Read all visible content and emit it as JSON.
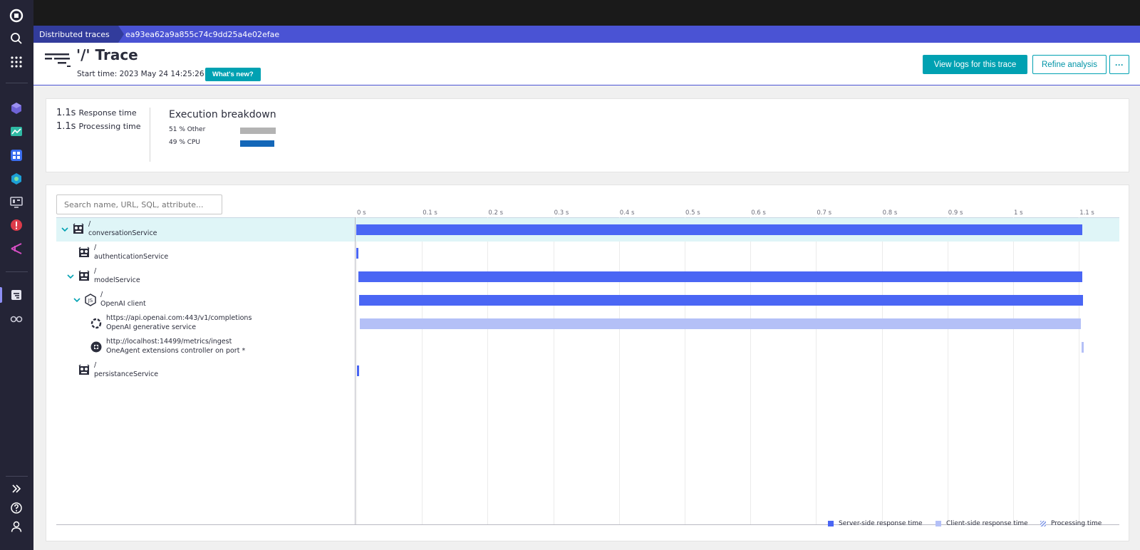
{
  "breadcrumb": {
    "first": "Distributed traces",
    "second": "ea93ea62a9a855c74c9dd25a4e02efae"
  },
  "header": {
    "title": "'/' Trace",
    "start_time": "Start time: 2023 May 24 14:25:26",
    "whats_new": "What's new?",
    "view_logs_button": "View logs for this trace",
    "refine_button": "Refine analysis",
    "more_button": "···"
  },
  "summary": {
    "response_time_value": "1.1s",
    "response_time_label": "Response time",
    "processing_time_value": "1.1s",
    "processing_time_label": "Processing time",
    "breakdown_title": "Execution breakdown",
    "breakdown": [
      {
        "label": "51 % Other",
        "percent": 51,
        "color": "#b3b3b3"
      },
      {
        "label": "49 % CPU",
        "percent": 49,
        "color": "#1467b8"
      }
    ]
  },
  "search": {
    "placeholder": "Search name, URL, SQL, attribute..."
  },
  "timeline": {
    "ticks": [
      "0 s",
      "0.1 s",
      "0.2 s",
      "0.3 s",
      "0.4 s",
      "0.5 s",
      "0.6 s",
      "0.7 s",
      "0.8 s",
      "0.9 s",
      "1 s",
      "1.1 s"
    ]
  },
  "rows": [
    {
      "name": "/",
      "service": "conversationService",
      "start_s": 0.0,
      "end_s": 1.105,
      "kind": "server",
      "expandable": true,
      "selected": true
    },
    {
      "name": "/",
      "service": "authenticationService",
      "start_s": 0.0,
      "end_s": 0.003,
      "kind": "server",
      "expandable": false
    },
    {
      "name": "/",
      "service": "modelService",
      "start_s": 0.003,
      "end_s": 1.105,
      "kind": "server",
      "expandable": true
    },
    {
      "name": "/",
      "service": "OpenAI client",
      "start_s": 0.004,
      "end_s": 1.106,
      "kind": "server",
      "expandable": true
    },
    {
      "name": "https://api.openai.com:443/v1/completions",
      "service": "OpenAI generative service",
      "start_s": 0.005,
      "end_s": 1.103,
      "kind": "client",
      "expandable": false
    },
    {
      "name": "http://localhost:14499/metrics/ingest",
      "service": "OneAgent extensions controller on port *",
      "start_s": 1.104,
      "end_s": 1.107,
      "kind": "client",
      "expandable": false
    },
    {
      "name": "/",
      "service": "persistanceService",
      "start_s": 0.001,
      "end_s": 0.004,
      "kind": "server",
      "expandable": false
    }
  ],
  "legend": [
    {
      "label": "Server-side response time",
      "color": "#4a66f4"
    },
    {
      "label": "Client-side response time",
      "color": "#b4c0f7"
    },
    {
      "label": "Processing time",
      "color": "#8aa0e8"
    }
  ]
}
